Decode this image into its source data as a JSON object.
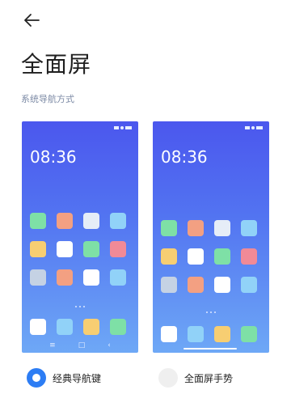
{
  "header": {
    "back_icon": "arrow-left-icon",
    "title": "全面屏"
  },
  "section_label": "系统导航方式",
  "previews": [
    {
      "name": "classic",
      "time": "08:36",
      "nav": {
        "menu": "≡",
        "home": "□",
        "back": "‹"
      },
      "tiles": [
        "#7ee0a6",
        "#f3a082",
        "#e6edf7",
        "#91d2f8",
        "#f7ce72",
        "#ffffff",
        "#7ee0a6",
        "#f18a97",
        "#c5d2e4",
        "#f3a082",
        "#ffffff",
        "#91d2f8"
      ],
      "dock": [
        "#ffffff",
        "#91d2f8",
        "#f7ce72",
        "#7ee0a6"
      ]
    },
    {
      "name": "gesture",
      "time": "08:36",
      "tiles": [
        "#7ee0a6",
        "#f3a082",
        "#e6edf7",
        "#91d2f8",
        "#f7ce72",
        "#ffffff",
        "#7ee0a6",
        "#f18a97",
        "#c5d2e4",
        "#f3a082",
        "#ffffff",
        "#91d2f8"
      ],
      "dock": [
        "#ffffff",
        "#91d2f8",
        "#f7ce72",
        "#7ee0a6"
      ]
    }
  ],
  "options": [
    {
      "label": "经典导航键",
      "selected": true
    },
    {
      "label": "全面屏手势",
      "selected": false
    }
  ],
  "colors": {
    "accent": "#2d7df4"
  }
}
